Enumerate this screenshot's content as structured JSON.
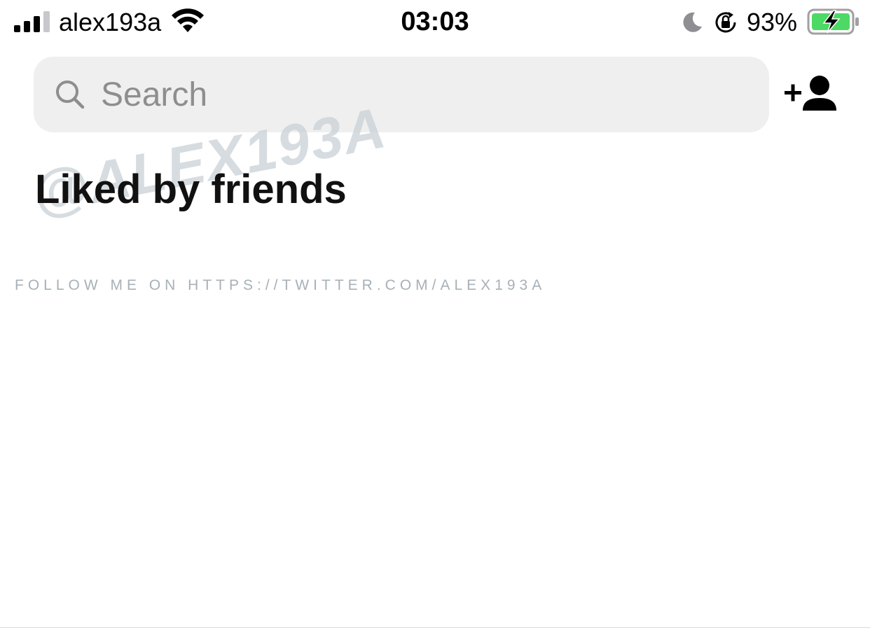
{
  "status_bar": {
    "carrier": "alex193a",
    "time": "03:03",
    "battery_percent": "93%",
    "signal_bars_active": 3,
    "signal_bars_total": 4,
    "icons": [
      "signal-icon",
      "wifi-icon",
      "moon-icon",
      "rotation-lock-icon",
      "battery-charging-icon"
    ],
    "battery_color": "#4cd964"
  },
  "search": {
    "placeholder": "Search",
    "value": ""
  },
  "header_actions": {
    "add_friend_icon": "add-friend-icon"
  },
  "section": {
    "title": "Liked by friends"
  },
  "watermark": {
    "handle": "@ALEX193A",
    "follow_text": "FOLLOW ME ON HTTPS://TWITTER.COM/ALEX193A"
  }
}
